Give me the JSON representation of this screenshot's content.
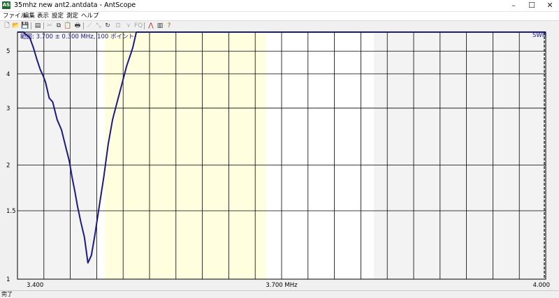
{
  "window": {
    "title": "35mhz new ant2.antdata - AntScope",
    "icon_name": "antscope-app-icon",
    "controls": [
      "–",
      "☐",
      "✕"
    ]
  },
  "menu": {
    "items": [
      "ファイル",
      "編集",
      "表示",
      "設定",
      "測定",
      "ヘルプ"
    ]
  },
  "toolbar": {
    "icons": [
      "new-file-icon",
      "open-file-icon",
      "save-icon",
      "print-setup-icon",
      "cut-icon",
      "copy-icon",
      "paste-icon",
      "print-icon",
      "graph-icon",
      "scale-icon",
      "refresh-icon",
      "zoom-icon",
      "filter-icon",
      "fq-icon",
      "swr-chart-icon",
      "table-icon",
      "help-icon"
    ]
  },
  "chart": {
    "range_text": "範囲: 3.700 ± 0.300 MHz, 100 ポイント",
    "swr_label": "SWR",
    "y_ticks": [
      "5",
      "4",
      "3",
      "2",
      "1.5",
      "1"
    ],
    "x_ticks": [
      "3.400",
      "3.700 MHz",
      "4.000"
    ],
    "colors": {
      "curve": "#1a1a80",
      "band": "#ffffe0",
      "plot_bg": "#ffffff",
      "outside": "#f0f0f0"
    }
  },
  "chart_data": {
    "type": "line",
    "title": "",
    "xlabel": "MHz",
    "ylabel": "SWR",
    "xlim": [
      3.4,
      4.0
    ],
    "ylim": [
      1,
      6.2
    ],
    "y_scale": "reflection-mapped (SWR)",
    "band": [
      3.5,
      3.8
    ],
    "series": [
      {
        "x": [
          3.4,
          3.407,
          3.41,
          3.414,
          3.418,
          3.422,
          3.426,
          3.429,
          3.432,
          3.436,
          3.44,
          3.445,
          3.45,
          3.455,
          3.459,
          3.462,
          3.465,
          3.468,
          3.472,
          3.476,
          3.48,
          3.484,
          3.488,
          3.493,
          3.498,
          3.503,
          3.508,
          3.515,
          3.524,
          3.529,
          3.531,
          3.535,
          3.8,
          4.0
        ],
        "values": [
          6.2,
          6.2,
          6.0,
          5.8,
          5.2,
          4.6,
          4.15,
          3.95,
          3.7,
          3.25,
          3.15,
          2.75,
          2.55,
          2.25,
          2.05,
          1.85,
          1.7,
          1.55,
          1.4,
          1.28,
          1.1,
          1.15,
          1.3,
          1.55,
          1.85,
          2.3,
          2.75,
          3.3,
          4.3,
          4.9,
          5.2,
          6.2,
          6.2,
          6.2
        ]
      }
    ]
  },
  "status": {
    "text": "完了"
  }
}
